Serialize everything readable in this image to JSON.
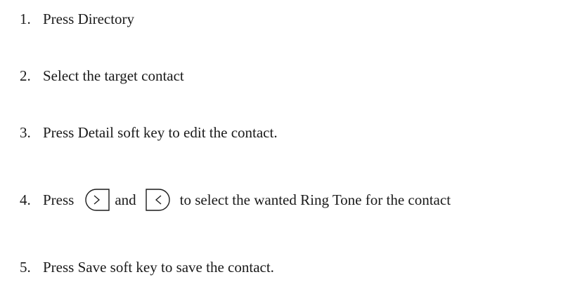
{
  "steps": [
    {
      "number": "1.",
      "text": "Press Directory"
    },
    {
      "number": "2.",
      "text": "Select the target contact"
    },
    {
      "number": "3.",
      "text": "Press Detail soft key to edit the contact."
    },
    {
      "number": "4.",
      "before": "Press",
      "key1_icon": "right-arrow-key-icon",
      "middle": "and",
      "key2_icon": "left-arrow-key-icon",
      "after": "to select the wanted Ring Tone for the contact"
    },
    {
      "number": "5.",
      "text": "Press Save soft key to save the contact."
    }
  ]
}
